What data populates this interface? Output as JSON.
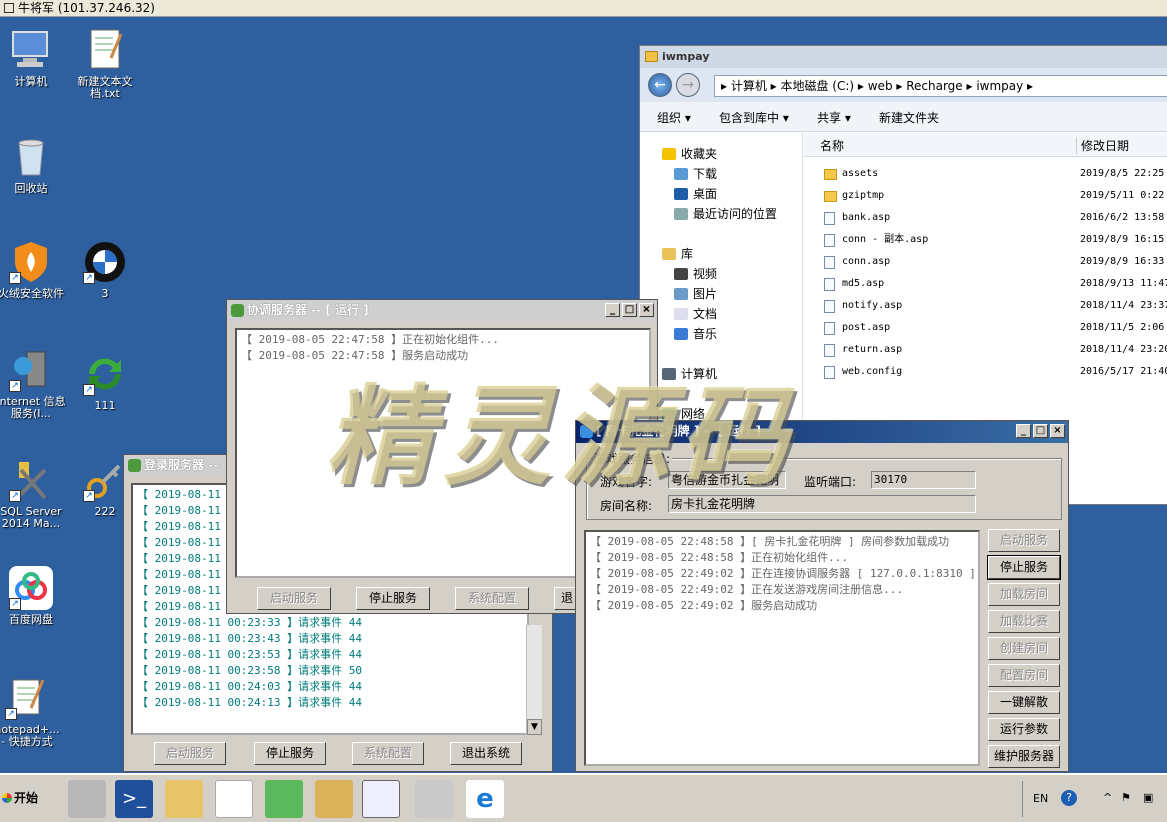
{
  "rdp_title": "牛将军 (101.37.246.32)",
  "desktop_icons": [
    {
      "label": "计算机"
    },
    {
      "label": "新建文本文档.txt"
    },
    {
      "label": "回收站"
    },
    {
      "label": "火绒安全软件"
    },
    {
      "label": "3"
    },
    {
      "label": "Internet 信息服务(I..."
    },
    {
      "label": "111"
    },
    {
      "label": "SQL Server 2014 Ma..."
    },
    {
      "label": "222"
    },
    {
      "label": "百度网盘"
    },
    {
      "label": "notepad+... - 快捷方式"
    }
  ],
  "explorer": {
    "title": "iwmpay",
    "address": "▸ 计算机 ▸ 本地磁盘 (C:) ▸ web ▸ Recharge ▸ iwmpay ▸",
    "toolbar": [
      "组织 ▾",
      "包含到库中 ▾",
      "共享 ▾",
      "新建文件夹"
    ],
    "nav": [
      "收藏夹",
      "下载",
      "桌面",
      "最近访问的位置",
      "库",
      "视频",
      "图片",
      "文档",
      "音乐",
      "计算机",
      "网络"
    ],
    "col_name": "名称",
    "col_date": "修改日期",
    "files": [
      {
        "name": "assets",
        "date": "2019/8/5 22:25",
        "folder": true
      },
      {
        "name": "gziptmp",
        "date": "2019/5/11 0:22",
        "folder": true
      },
      {
        "name": "bank.asp",
        "date": "2016/6/2 13:58",
        "folder": false
      },
      {
        "name": "conn - 副本.asp",
        "date": "2019/8/9 16:15",
        "folder": false
      },
      {
        "name": "conn.asp",
        "date": "2019/8/9 16:33",
        "folder": false
      },
      {
        "name": "md5.asp",
        "date": "2018/9/13 11:47",
        "folder": false
      },
      {
        "name": "notify.asp",
        "date": "2018/11/4 23:37",
        "folder": false
      },
      {
        "name": "post.asp",
        "date": "2018/11/5 2:06",
        "folder": false
      },
      {
        "name": "return.asp",
        "date": "2018/11/4 23:20",
        "folder": false
      },
      {
        "name": "web.config",
        "date": "2016/5/17 21:40",
        "folder": false
      }
    ]
  },
  "login_server": {
    "title": "登录服务器 --",
    "logs_partial": [
      "【 2019-08-11 00",
      "【 2019-08-11 00",
      "【 2019-08-11 00",
      "【 2019-08-11 00",
      "【 2019-08-11 00",
      "【 2019-08-11 00",
      "【 2019-08-11 00",
      "【 2019-08-11 00"
    ],
    "logs": [
      "【 2019-08-11 00:23:33 】请求事件  44",
      "【 2019-08-11 00:23:43 】请求事件  44",
      "【 2019-08-11 00:23:53 】请求事件  44",
      "【 2019-08-11 00:23:58 】请求事件  50",
      "【 2019-08-11 00:24:03 】请求事件  44",
      "【 2019-08-11 00:24:13 】请求事件  44"
    ],
    "buttons": [
      "启动服务",
      "停止服务",
      "系统配置",
      "退出系统"
    ]
  },
  "coord_server": {
    "title": "协调服务器 -- [ 运行 ]",
    "logs": [
      "【 2019-08-05 22:47:58 】正在初始化组件...",
      "【 2019-08-05 22:47:58 】服务启动成功"
    ],
    "buttons": [
      "启动服务",
      "停止服务",
      "系统配置",
      "退"
    ]
  },
  "room_server": {
    "title": "[ 房卡扎金花明牌 ] -- [ 运行 ]",
    "group_label": "游戏服务信息:",
    "game_name_label": "游戏名字:",
    "game_name_value": "粤信游金币扎金花明",
    "port_label": "监听端口:",
    "port_value": "30170",
    "room_name_label": "房间名称:",
    "room_name_value": "房卡扎金花明牌",
    "logs": [
      "【 2019-08-05 22:48:58 】[ 房卡扎金花明牌 ] 房间参数加载成功",
      "【 2019-08-05 22:48:58 】正在初始化组件...",
      "【 2019-08-05 22:49:02 】正在连接协调服务器 [ 127.0.0.1:8310 ]",
      "【 2019-08-05 22:49:02 】正在发送游戏房间注册信息...",
      "【 2019-08-05 22:49:02 】服务启动成功"
    ],
    "buttons": [
      "启动服务",
      "停止服务",
      "加载房间",
      "加载比赛",
      "创建房间",
      "配置房间",
      "一键解散",
      "运行参数",
      "维护服务器"
    ]
  },
  "watermark": "精灵源码",
  "taskbar": {
    "start": "开始",
    "lang": "EN"
  }
}
